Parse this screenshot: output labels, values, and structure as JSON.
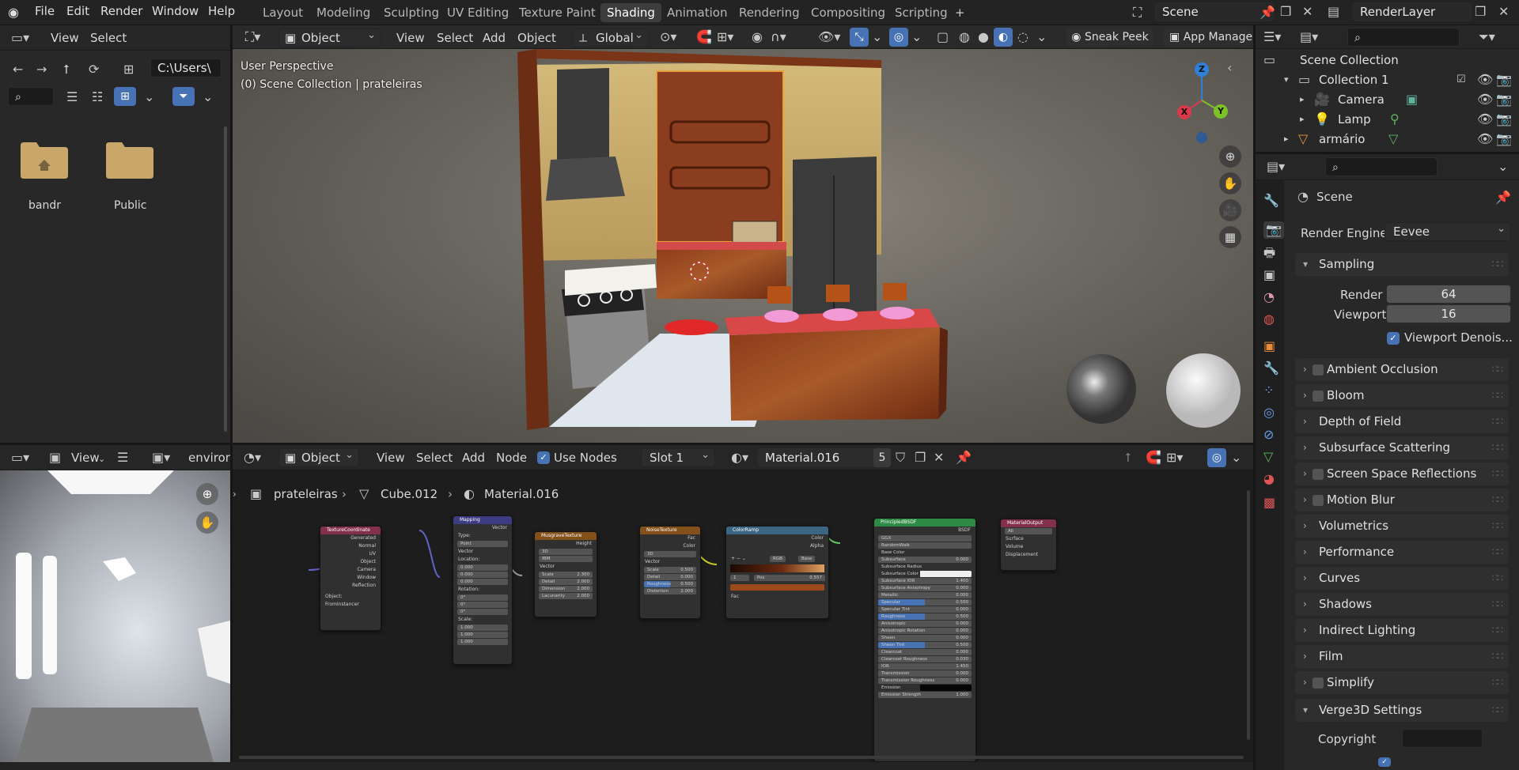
{
  "topbar": {
    "menus": [
      "File",
      "Edit",
      "Render",
      "Window",
      "Help"
    ],
    "workspaces": [
      "Layout",
      "Modeling",
      "Sculpting",
      "UV Editing",
      "Texture Paint",
      "Shading",
      "Animation",
      "Rendering",
      "Compositing",
      "Scripting"
    ],
    "active_workspace": "Shading",
    "add_tab": "+",
    "scene": "Scene",
    "view_layer": "RenderLayer"
  },
  "file_browser": {
    "menus": [
      "View",
      "Select"
    ],
    "path": "C:\\Users\\",
    "folders": [
      "bandr",
      "Public"
    ]
  },
  "viewport": {
    "mode": "Object Mode",
    "menus": [
      "View",
      "Select",
      "Add",
      "Object"
    ],
    "orientation": "Global",
    "sneak_peek": "Sneak Peek",
    "app_manager": "App Manage",
    "overlay_title": "User Perspective",
    "overlay_sub": "(0) Scene Collection | prateleiras",
    "gizmo": {
      "x": "X",
      "y": "Y",
      "z": "Z"
    }
  },
  "image_editor": {
    "view": "View",
    "image_name": "environr"
  },
  "node_editor": {
    "type": "Object",
    "menus": [
      "View",
      "Select",
      "Add",
      "Node"
    ],
    "use_nodes": "Use Nodes",
    "slot": "Slot 1",
    "material": "Material.016",
    "users": "5",
    "breadcrumb": [
      "prateleiras",
      "Cube.012",
      "Material.016"
    ],
    "nodes": {
      "texcoord": {
        "title": "TextureCoordinate",
        "outputs": [
          "Generated",
          "Normal",
          "UV",
          "Object",
          "Camera",
          "Window",
          "Reflection"
        ],
        "object_label": "Object:",
        "from_instancer": "FromInstancer"
      },
      "mapping": {
        "title": "Mapping",
        "out": "Vector",
        "type_label": "Type:",
        "type": "Point",
        "vector": "Vector",
        "location": "Location:",
        "rotation": "Rotation:",
        "scale": "Scale:",
        "loc": [
          "X",
          "0.000",
          "Y",
          "0.000",
          "Z",
          "0.000"
        ],
        "rot": [
          "X",
          "0°",
          "Y",
          "0°",
          "Z",
          "0°"
        ],
        "scl": [
          "X",
          "1.000",
          "Y",
          "1.000",
          "Z",
          "1.000"
        ]
      },
      "musgrave": {
        "title": "MusgraveTexture",
        "out": "Height",
        "dim": "3D",
        "kind": "fBM",
        "vector": "Vector",
        "fields": [
          [
            "Scale",
            "2.300"
          ],
          [
            "Detail",
            "2.000"
          ],
          [
            "Dimension",
            "2.000"
          ],
          [
            "Lacunarity",
            "2.000"
          ]
        ]
      },
      "noise": {
        "title": "NoiseTexture",
        "outs": [
          "Fac",
          "Color"
        ],
        "dim": "3D",
        "vector": "Vector",
        "fields": [
          [
            "Scale",
            "0.500"
          ],
          [
            "Detail",
            "0.000"
          ],
          [
            "Roughness",
            "0.500"
          ],
          [
            "Distortion",
            "2.000"
          ]
        ]
      },
      "ramp": {
        "title": "ColorRamp",
        "outs": [
          "Color",
          "Alpha"
        ],
        "mode": "RGB",
        "interp": "Base",
        "index": "1",
        "pos_label": "Pos",
        "pos": "0.557",
        "in": "Fac"
      },
      "bsdf": {
        "title": "PrincipledBSDF",
        "out": "BSDF",
        "dist": "GGX",
        "sss": "RandomWalk",
        "rows": [
          [
            "Base Color",
            ""
          ],
          [
            "Subsurface",
            "0.000"
          ],
          [
            "Subsurface Radius",
            ""
          ],
          [
            "Subsurface Color",
            ""
          ],
          [
            "Subsurface IOR",
            "1.400"
          ],
          [
            "Subsurface Anisotropy",
            "0.000"
          ],
          [
            "Metallic",
            "0.000"
          ],
          [
            "Specular",
            "0.500"
          ],
          [
            "Specular Tint",
            "0.000"
          ],
          [
            "Roughness",
            "0.500"
          ],
          [
            "Anisotropic",
            "0.000"
          ],
          [
            "Anisotropic Rotation",
            "0.000"
          ],
          [
            "Sheen",
            "0.000"
          ],
          [
            "Sheen Tint",
            "0.500"
          ],
          [
            "Clearcoat",
            "0.000"
          ],
          [
            "Clearcoat Roughness",
            "0.030"
          ],
          [
            "IOR",
            "1.450"
          ],
          [
            "Transmission",
            "0.000"
          ],
          [
            "Transmission Roughness",
            "0.000"
          ],
          [
            "Emission",
            ""
          ],
          [
            "Emission Strength",
            "1.000"
          ]
        ]
      },
      "output": {
        "title": "MaterialOutput",
        "target": "All",
        "inputs": [
          "Surface",
          "Volume",
          "Displacement"
        ]
      }
    }
  },
  "outliner": {
    "title": "Scene Collection",
    "items": [
      {
        "name": "Collection 1",
        "level": 1
      },
      {
        "name": "Camera",
        "level": 2
      },
      {
        "name": "Lamp",
        "level": 2
      },
      {
        "name": "armário",
        "level": 1
      }
    ]
  },
  "properties": {
    "context": "Scene",
    "render_engine_label": "Render Engine",
    "render_engine": "Eevee",
    "sampling": "Sampling",
    "render_label": "Render",
    "render_samples": "64",
    "viewport_label": "Viewport",
    "viewport_samples": "16",
    "viewport_denoise": "Viewport Denois...",
    "panels": [
      {
        "label": "Ambient Occlusion",
        "checkbox": true
      },
      {
        "label": "Bloom",
        "checkbox": true
      },
      {
        "label": "Depth of Field",
        "checkbox": false
      },
      {
        "label": "Subsurface Scattering",
        "checkbox": false
      },
      {
        "label": "Screen Space Reflections",
        "checkbox": true
      },
      {
        "label": "Motion Blur",
        "checkbox": true
      },
      {
        "label": "Volumetrics",
        "checkbox": false
      },
      {
        "label": "Performance",
        "checkbox": false
      },
      {
        "label": "Curves",
        "checkbox": false
      },
      {
        "label": "Shadows",
        "checkbox": false
      },
      {
        "label": "Indirect Lighting",
        "checkbox": false
      },
      {
        "label": "Film",
        "checkbox": false
      },
      {
        "label": "Simplify",
        "checkbox": true
      }
    ],
    "verge": "Verge3D Settings",
    "copyright": "Copyright"
  },
  "colors": {
    "accent": "#4772b3",
    "active_outline": "#e8a03c"
  }
}
